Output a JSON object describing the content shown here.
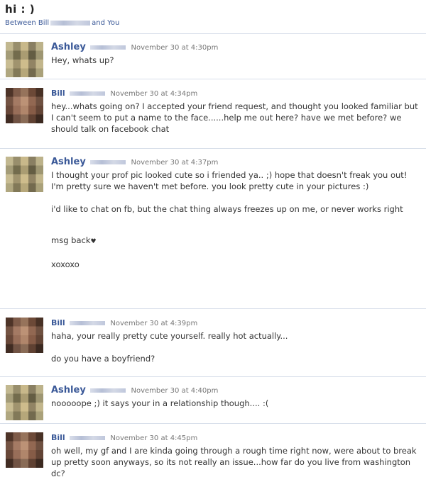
{
  "thread": {
    "title": "hi : )",
    "between_prefix": "Between Bill",
    "between_suffix": "and You"
  },
  "messages": [
    {
      "sender": "Ashley",
      "time": "November 30 at 4:30pm",
      "lines": [
        "Hey, whats up?"
      ]
    },
    {
      "sender": "Bill",
      "time": "November 30 at 4:34pm",
      "lines": [
        "hey...whats going on? I accepted your friend request, and thought you looked familiar but I can't seem to put a name to the face......help me out here? have we met before? we should talk on facebook chat"
      ]
    },
    {
      "sender": "Ashley",
      "time": "November 30 at 4:37pm",
      "lines": [
        "I thought your prof pic looked cute so i friended ya.. ;) hope that doesn't freak you out! I'm pretty sure we haven't met before. you look pretty cute in your pictures :)",
        "i'd like to chat on fb, but the chat thing always freezes up on me, or never works right",
        "msg back",
        "xoxoxo"
      ],
      "heart": "♥"
    },
    {
      "sender": "Bill",
      "time": "November 30 at 4:39pm",
      "lines": [
        "haha, your really pretty cute yourself. really hot actually...",
        "do you have a boyfriend?"
      ]
    },
    {
      "sender": "Ashley",
      "time": "November 30 at 4:40pm",
      "lines": [
        "nooooope ;) it says your in a relationship though.... :("
      ]
    },
    {
      "sender": "Bill",
      "time": "November 30 at 4:45pm",
      "lines": [
        "oh well, my gf and I are kinda going through a rough time right now, were about to break up pretty soon anyways, so its not really an issue...how far do you live from washington dc?"
      ]
    }
  ]
}
